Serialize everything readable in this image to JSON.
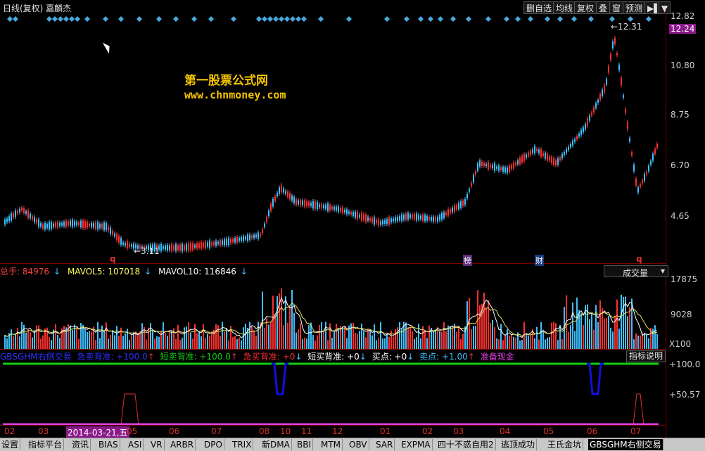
{
  "window": {
    "title": "日线(复权) 嘉麟杰",
    "buttons": [
      "删自选",
      "均线",
      "复权",
      "叠",
      "窗",
      "预测"
    ],
    "more_button": "▶▌",
    "dropdown_button": "▼"
  },
  "main_chart": {
    "y_labels": [
      "12.82",
      "12.24",
      "10.80",
      "8.75",
      "6.70",
      "4.65"
    ],
    "current_price": "12.24",
    "high_annotation": "←12.31",
    "low_annotation": "←3.11",
    "markers": [
      "q",
      "榜",
      "财",
      "q"
    ],
    "watermark_line1": "第一股票公式网",
    "watermark_line2": "www.chnmoney.com"
  },
  "volume_panel": {
    "total_label": "总手: 84976",
    "ma5_label": "MAVOL5: 107018",
    "ma10_label": "MAVOL10: 116846",
    "selector": "成交量",
    "y_labels": [
      "17875",
      "9028",
      "X100"
    ]
  },
  "indicator_panel": {
    "name": "GBSGHM右侧交易",
    "items": [
      {
        "label": "急卖背准: +100.0",
        "arrow": "↑"
      },
      {
        "label": "短卖背准: +100.0",
        "arrow": "↑"
      },
      {
        "label": "急买背准: +0",
        "arrow": "↓"
      },
      {
        "label": "短买背准: +0",
        "arrow": "↓"
      },
      {
        "label": "买点: +0",
        "arrow": "↓"
      },
      {
        "label": "卖点: +1.00",
        "arrow": "↑"
      },
      {
        "label": "准备现金",
        "arrow": ""
      }
    ],
    "help_button": "指标说明",
    "y_labels": [
      "+100.0",
      "+50.57"
    ]
  },
  "date_axis": {
    "labels": [
      "02",
      "03",
      "05",
      "06",
      "07",
      "08",
      "10",
      "11",
      "12",
      "01",
      "02",
      "03",
      "04",
      "05",
      "06",
      "07"
    ],
    "highlight": "2014-03-21,五"
  },
  "tabs": [
    "设置",
    "指标平台",
    "资讯",
    "BIAS",
    "ASI",
    "VR",
    "ARBR",
    "DPO",
    "TRIX",
    "新DMA",
    "BBI",
    "MTM",
    "OBV",
    "SAR",
    "EXPMA",
    "四十不惑自用2",
    "逃顶成功",
    "王氏金坑",
    "GBSGHM右侧交易"
  ],
  "active_tab": "GBSGHM右侧交易",
  "colors": {
    "up": "#ff3030",
    "down": "#40c0ff",
    "diamond": "#4aa8e0",
    "ind_line": "#e040e0",
    "green_line": "#10d010",
    "blue_line": "#1010e0"
  }
}
